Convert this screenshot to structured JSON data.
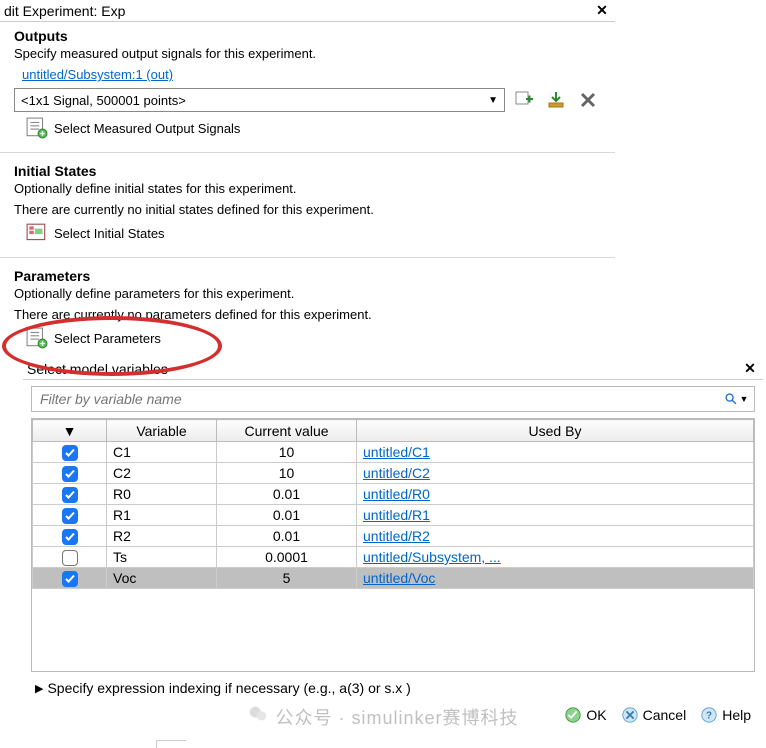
{
  "topDialog": {
    "title": "dit Experiment: Exp",
    "outputs": {
      "heading": "Outputs",
      "desc": "Specify measured output signals for this experiment.",
      "link": "untitled/Subsystem:1 (out)",
      "signal": "<1x1 Signal, 500001 points>",
      "selectBtn": "Select Measured Output Signals"
    },
    "initialStates": {
      "heading": "Initial States",
      "desc": "Optionally define initial states for this experiment.",
      "status": "There are currently no initial states defined for this experiment.",
      "selectBtn": "Select Initial States"
    },
    "parameters": {
      "heading": "Parameters",
      "desc": "Optionally define parameters for this experiment.",
      "status": "There are currently no parameters defined for this experiment.",
      "selectBtn": "Select Parameters"
    }
  },
  "lowerDialog": {
    "title": "Select model variables",
    "filterPlaceholder": "Filter by variable name",
    "headers": {
      "chk": "▼",
      "variable": "Variable",
      "currentValue": "Current value",
      "usedBy": "Used By"
    },
    "rows": [
      {
        "checked": true,
        "variable": "C1",
        "value": "10",
        "usedBy": "untitled/C1",
        "selected": false
      },
      {
        "checked": true,
        "variable": "C2",
        "value": "10",
        "usedBy": "untitled/C2",
        "selected": false
      },
      {
        "checked": true,
        "variable": "R0",
        "value": "0.01",
        "usedBy": "untitled/R0",
        "selected": false
      },
      {
        "checked": true,
        "variable": "R1",
        "value": "0.01",
        "usedBy": "untitled/R1",
        "selected": false
      },
      {
        "checked": true,
        "variable": "R2",
        "value": "0.01",
        "usedBy": "untitled/R2",
        "selected": false
      },
      {
        "checked": false,
        "variable": "Ts",
        "value": "0.0001",
        "usedBy": "untitled/Subsystem, ...",
        "selected": false
      },
      {
        "checked": true,
        "variable": "Voc",
        "value": "5",
        "usedBy": "untitled/Voc",
        "selected": true
      }
    ],
    "exprLabel": "Specify expression indexing if necessary (e.g., a(3) or s.x )",
    "buttons": {
      "ok": "OK",
      "cancel": "Cancel",
      "help": "Help"
    }
  },
  "watermark": "公众号 · simulinker赛博科技"
}
